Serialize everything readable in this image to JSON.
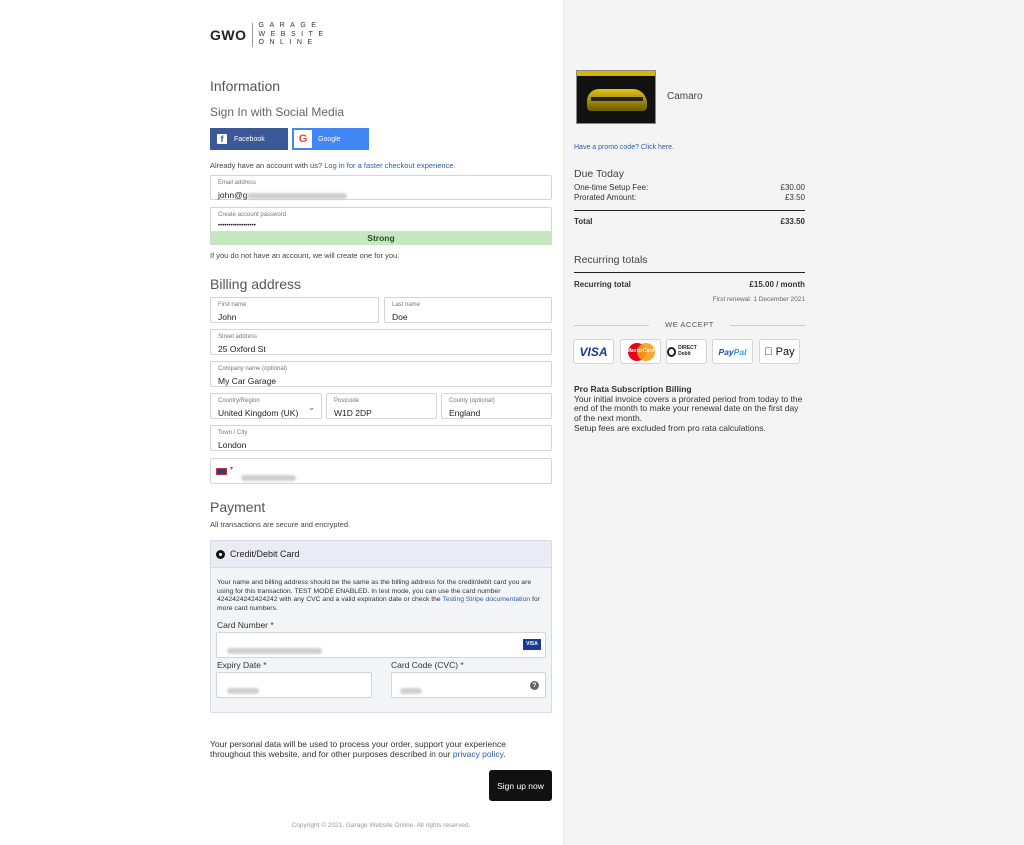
{
  "logo": {
    "mark": "GWO",
    "line1": "GARAGE",
    "line2": "WEBSITE",
    "line3": "ONLINE"
  },
  "information": {
    "heading": "Information",
    "social_heading": "Sign In with Social Media",
    "facebook_label": "Facebook",
    "google_label": "Google",
    "have_account_text": "Already have an account with us?",
    "login_link": "Log in for a faster checkout experience.",
    "email_label": "Email address",
    "email_value": "john@g",
    "password_label": "Create account password",
    "password_value": "••••••••••••••••••",
    "strength": "Strong",
    "no_account_note": "If you do not have an account, we will create one for you."
  },
  "billing": {
    "heading": "Billing address",
    "first_name_label": "First name",
    "first_name": "John",
    "last_name_label": "Last name",
    "last_name": "Doe",
    "street_label": "Street address",
    "street": "25 Oxford St",
    "company_label": "Company name (optional)",
    "company": "My Car Garage",
    "country_label": "Country/Region",
    "country": "United Kingdom (UK)",
    "postcode_label": "Postcode",
    "postcode": "W1D 2DP",
    "county_label": "County (optional)",
    "county": "England",
    "town_label": "Town / City",
    "town": "London"
  },
  "payment": {
    "heading": "Payment",
    "secure_note": "All transactions are secure and encrypted.",
    "method": "Credit/Debit Card",
    "note_pre": "Your name and billing address should be the same as the billing address for the credit/debit card you are using for this transaction. TEST MODE ENABLED. In test mode, you can use the card number 4242424242424242 with any CVC and a valid expiration date or check the",
    "note_link": "Testing Stripe documentation",
    "note_post": "for more card numbers.",
    "card_number_label": "Card Number *",
    "expiry_label": "Expiry Date *",
    "cvc_label": "Card Code (CVC) *",
    "card_brand": "VISA"
  },
  "footer": {
    "privacy_pre": "Your personal data will be used to process your order, support your experience throughout this website, and for other purposes described in our",
    "privacy_link": "privacy policy",
    "privacy_post": ".",
    "signup": "Sign up now",
    "copyright": "Copyright © 2021, Garage Website Online. All rights reserved."
  },
  "summary": {
    "product": "Camaro",
    "promo": "Have a promo code? Click here.",
    "due_today": "Due Today",
    "setup_label": "One-time Setup Fee:",
    "setup_value": "£30.00",
    "prorated_label": "Prorated Amount:",
    "prorated_value": "£3.50",
    "total_label": "Total",
    "total_value": "£33.50",
    "recurring_heading": "Recurring totals",
    "recurring_label": "Recurring total",
    "recurring_value": "£15.00 / month",
    "renewal": "First renewal: 1 December 2021",
    "we_accept": "WE ACCEPT",
    "cards": {
      "visa": "VISA",
      "mastercard": "MasterCard",
      "direct_debit": "DIRECT Debit",
      "paypal_a": "Pay",
      "paypal_b": "Pal",
      "applepay": " Pay"
    },
    "prorata_title": "Pro Rata Subscription Billing",
    "prorata_text": "Your initial invoice covers a prorated period from today to the end of the month to make your renewal date on the first day of the next month.",
    "prorata_note": "Setup fees are excluded from pro rata calculations."
  }
}
